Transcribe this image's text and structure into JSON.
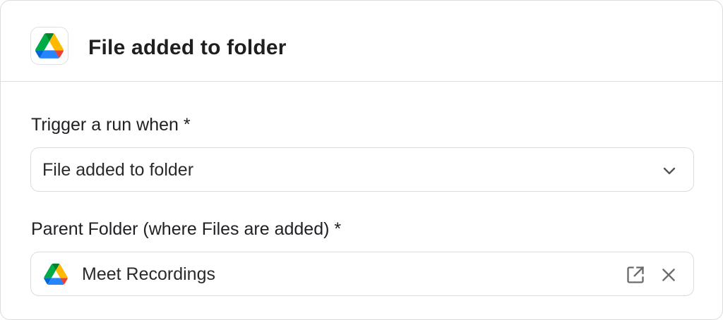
{
  "header": {
    "title": "File added to folder",
    "app_icon": "google-drive-icon"
  },
  "trigger": {
    "label": "Trigger a run when *",
    "value": "File added to folder",
    "icon": "chevron-down-icon"
  },
  "parent_folder": {
    "label": "Parent Folder (where Files are added) *",
    "value": "Meet Recordings",
    "icons": [
      "google-drive-icon",
      "open-external-icon",
      "close-icon"
    ]
  },
  "colors": {
    "drive_green": "#0F9D58",
    "drive_yellow": "#FFBA00",
    "drive_blue": "#2684FC",
    "drive_blue_dark": "#1967D2",
    "drive_red": "#EA4335",
    "icon_gray": "#6b6b6b",
    "border": "#dcdcdc"
  }
}
